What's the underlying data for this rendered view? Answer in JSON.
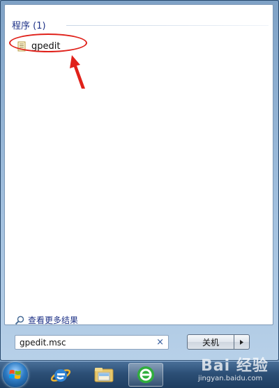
{
  "start_menu": {
    "group_header": "程序 (1)",
    "results": [
      {
        "label": "gpedit",
        "icon": "document-icon"
      }
    ],
    "see_more_label": "查看更多结果",
    "search": {
      "value": "gpedit.msc",
      "clear_glyph": "×"
    },
    "shutdown": {
      "label": "关机",
      "arrow_glyph": "▸"
    }
  },
  "taskbar": {
    "items": [
      {
        "name": "start-orb",
        "icon": "windows-logo-icon"
      },
      {
        "name": "internet-explorer",
        "icon": "ie-icon"
      },
      {
        "name": "windows-explorer",
        "icon": "folder-icon"
      },
      {
        "name": "browser",
        "icon": "browser-icon"
      }
    ]
  },
  "watermark": {
    "brand": "Bai 经验",
    "url": "jingyan.baidu.com"
  },
  "annotation": {
    "color": "#e0211a"
  }
}
